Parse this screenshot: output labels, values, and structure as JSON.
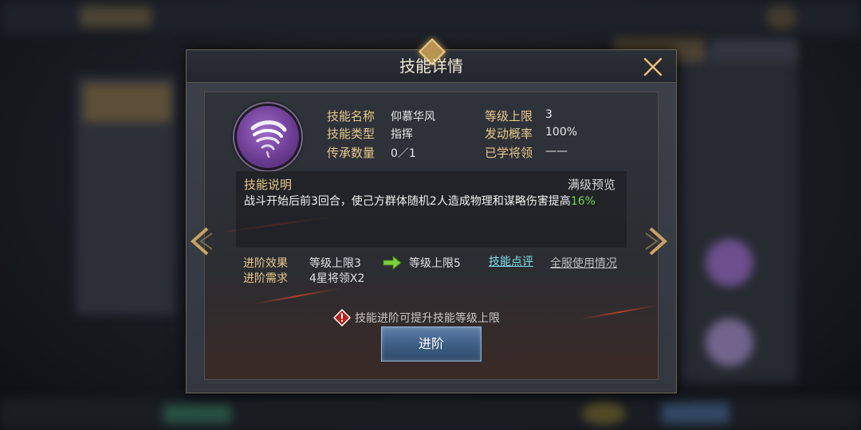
{
  "dialog": {
    "title": "技能详情",
    "close_icon": "close-icon"
  },
  "skill": {
    "icon": "whirlwind-icon",
    "name_label": "技能名称",
    "name_value": "仰慕华风",
    "type_label": "技能类型",
    "type_value": "指挥",
    "inherit_label": "传承数量",
    "inherit_value": "0／1",
    "level_cap_label": "等级上限",
    "level_cap_value": "3",
    "trigger_rate_label": "发动概率",
    "trigger_rate_value": "100%",
    "learned_label": "已学将领",
    "learned_value": "——"
  },
  "description": {
    "title": "技能说明",
    "preview_link": "满级预览",
    "text": "战斗开始后前3回合，使己方群体随机2人造成物理和谋略伤害提高",
    "highlight": "16%"
  },
  "advance": {
    "effect_label": "进阶效果",
    "effect_from": "等级上限3",
    "effect_to": "等级上限5",
    "arrow_icon": "green-arrow-right-icon",
    "require_label": "进阶需求",
    "require_value": "4星将领X2",
    "review_link": "技能点评",
    "usage_link": "全服使用情况",
    "tip_icon": "warning-icon",
    "tip_text": "技能进阶可提升技能等级上限",
    "button_label": "进阶"
  },
  "colors": {
    "gold_label": "#e7c98a",
    "highlight_green": "#6fd34a",
    "link_cyan": "#7fe0e8"
  }
}
